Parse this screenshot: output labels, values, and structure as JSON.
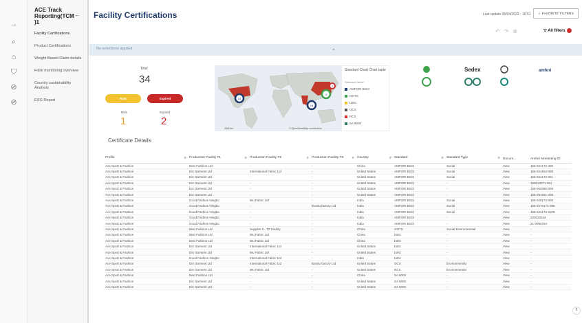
{
  "sidebar": {
    "title": "ACE Track Reporting(TCM )1",
    "items": [
      "Facility Certifications",
      "Product Certifications",
      "Weight Based Claim details",
      "Fibre monitoring overview",
      "Country sustainability Analysis",
      "ESG Report"
    ]
  },
  "header": {
    "title": "Facility Certifications",
    "last_update": "Last update 08/04/2023 - 16:51",
    "favorite": "FAVORITE FILTERS",
    "all_filters": "All filters"
  },
  "selection": {
    "text": "No selections applied"
  },
  "kpi": {
    "total_label": "Total",
    "total": "34",
    "risk_label": "Risk",
    "expired_label": "Expired",
    "risk_count": "1",
    "expired_count": "2",
    "risk_pill": "Risk",
    "expired_pill": "Expired"
  },
  "map": {
    "scale": "3000 km",
    "attribution": "© OpenStreetMap contributors",
    "bubbles": [
      "15",
      "18",
      "4",
      "1"
    ]
  },
  "legend": {
    "title": "Standard Chart Chart taple",
    "sub": "Standard Name",
    "items": [
      {
        "name": "AMFORI BSCI",
        "color": "#1e3a6b"
      },
      {
        "name": "GOTS",
        "color": "#3fa34d"
      },
      {
        "name": "LWG",
        "color": "#f1c232"
      },
      {
        "name": "OCS",
        "color": "#555555"
      },
      {
        "name": "RCS",
        "color": "#d32f2f"
      },
      {
        "name": "SA 8000",
        "color": "#2e7d6b"
      }
    ]
  },
  "logos": {
    "sedex": "Sedex",
    "amfori": "amfori"
  },
  "table": {
    "title": "Certificate Details",
    "headers": [
      "Profile",
      "Production Facility T1",
      "Production Facility T2",
      "Production Facility T3",
      "Country",
      "Standard",
      "Standard Type",
      "Docum...",
      "Amfori Monitoring ID"
    ],
    "rows": [
      [
        "Ace Sport & Fashion",
        "Best Fashion Ltd",
        "-",
        "-",
        "China",
        "AMFORI BSCI",
        "Social",
        "View",
        "156-024172-400"
      ],
      [
        "Ace Sport & Fashion",
        "Din Garment Ltd",
        "International Fabric Ltd",
        "-",
        "United States",
        "AMFORI BSCI",
        "Social",
        "View",
        "156-024162-008"
      ],
      [
        "Ace Sport & Fashion",
        "Din Garment Ltd",
        "-",
        "-",
        "United States",
        "AMFORI BSCI",
        "Social",
        "View",
        "156-024172-001"
      ],
      [
        "Ace Sport & Fashion",
        "Din Garment Ltd",
        "-",
        "-",
        "United States",
        "AMFORI BSCI",
        "-",
        "View",
        "150013071-001"
      ],
      [
        "Ace Sport & Fashion",
        "Din Garment Ltd",
        "-",
        "-",
        "United States",
        "AMFORI BSCI",
        "-",
        "View",
        "156-002080-008"
      ],
      [
        "Ace Sport & Fashion",
        "Din Garment Ltd",
        "-",
        "-",
        "United States",
        "AMFORI BSCI",
        "-",
        "View",
        "156-004931-008"
      ],
      [
        "Ace Sport & Fashion",
        "Good Fashion Ningbo",
        "Wu Fabric Ltd",
        "-",
        "India",
        "AMFORI BSCI",
        "Social",
        "View",
        "156-028173-008"
      ],
      [
        "Ace Sport & Fashion",
        "Good Fashion Ningbo",
        "-",
        "Bondu factory Ltd",
        "India",
        "AMFORI BSCI",
        "Social",
        "View",
        "156-0276172-089"
      ],
      [
        "Ace Sport & Fashion",
        "Good Fashion Ningbo",
        "-",
        "-",
        "India",
        "AMFORI BSCI",
        "Social",
        "View",
        "156-024172-3109"
      ],
      [
        "Ace Sport & Fashion",
        "Good Fashion Ningbo",
        "-",
        "-",
        "India",
        "AMFORI BSCI",
        "-",
        "View",
        "220123154"
      ],
      [
        "Ace Sport & Fashion",
        "Good Fashion Ningbo",
        "-",
        "-",
        "India",
        "AMFORI BSCI",
        "-",
        "View",
        "21-0006754"
      ],
      [
        "Ace Sport & Fashion",
        "Best Fashion Ltd",
        "Supplier 9 - T2 Facility",
        "-",
        "China",
        "GOTS",
        "Social Environmental",
        "View",
        "-"
      ],
      [
        "Ace Sport & Fashion",
        "Best Fashion Ltd",
        "Wu Fabric Ltd",
        "-",
        "China",
        "LWG",
        "-",
        "View",
        "-"
      ],
      [
        "Ace Sport & Fashion",
        "Best Fashion Ltd",
        "Wu Fabric Ltd",
        "-",
        "China",
        "LWG",
        "-",
        "View",
        "-"
      ],
      [
        "Ace Sport & Fashion",
        "Din Garment Ltd",
        "International Fabric Ltd",
        "-",
        "United States",
        "LWG",
        "-",
        "View",
        "-"
      ],
      [
        "Ace Sport & Fashion",
        "Din Garment Ltd",
        "Wu Fabric Ltd",
        "-",
        "United States",
        "LWG",
        "-",
        "View",
        "-"
      ],
      [
        "Ace Sport & Fashion",
        "Good Fashion Ningbo",
        "International Fabric Ltd",
        "-",
        "India",
        "LWG",
        "-",
        "View",
        "-"
      ],
      [
        "Ace Sport & Fashion",
        "Din Garment Ltd",
        "International Fabric Ltd",
        "Bondu factory Ltd",
        "United States",
        "OCS",
        "Environmental",
        "View",
        "-"
      ],
      [
        "Ace Sport & Fashion",
        "Din Garment Ltd",
        "Wu Fabric Ltd",
        "-",
        "United States",
        "RCS",
        "Environmental",
        "View",
        "-"
      ],
      [
        "Ace Sport & Fashion",
        "Best Fashion Ltd",
        "-",
        "-",
        "China",
        "SA 8000",
        "-",
        "View",
        "-"
      ],
      [
        "Ace Sport & Fashion",
        "Din Garment Ltd",
        "-",
        "-",
        "United States",
        "SA 8000",
        "-",
        "View",
        "-"
      ],
      [
        "Ace Sport & Fashion",
        "Din Garment Ltd",
        "-",
        "-",
        "United States",
        "SA 8000",
        "-",
        "View",
        "-"
      ]
    ]
  }
}
